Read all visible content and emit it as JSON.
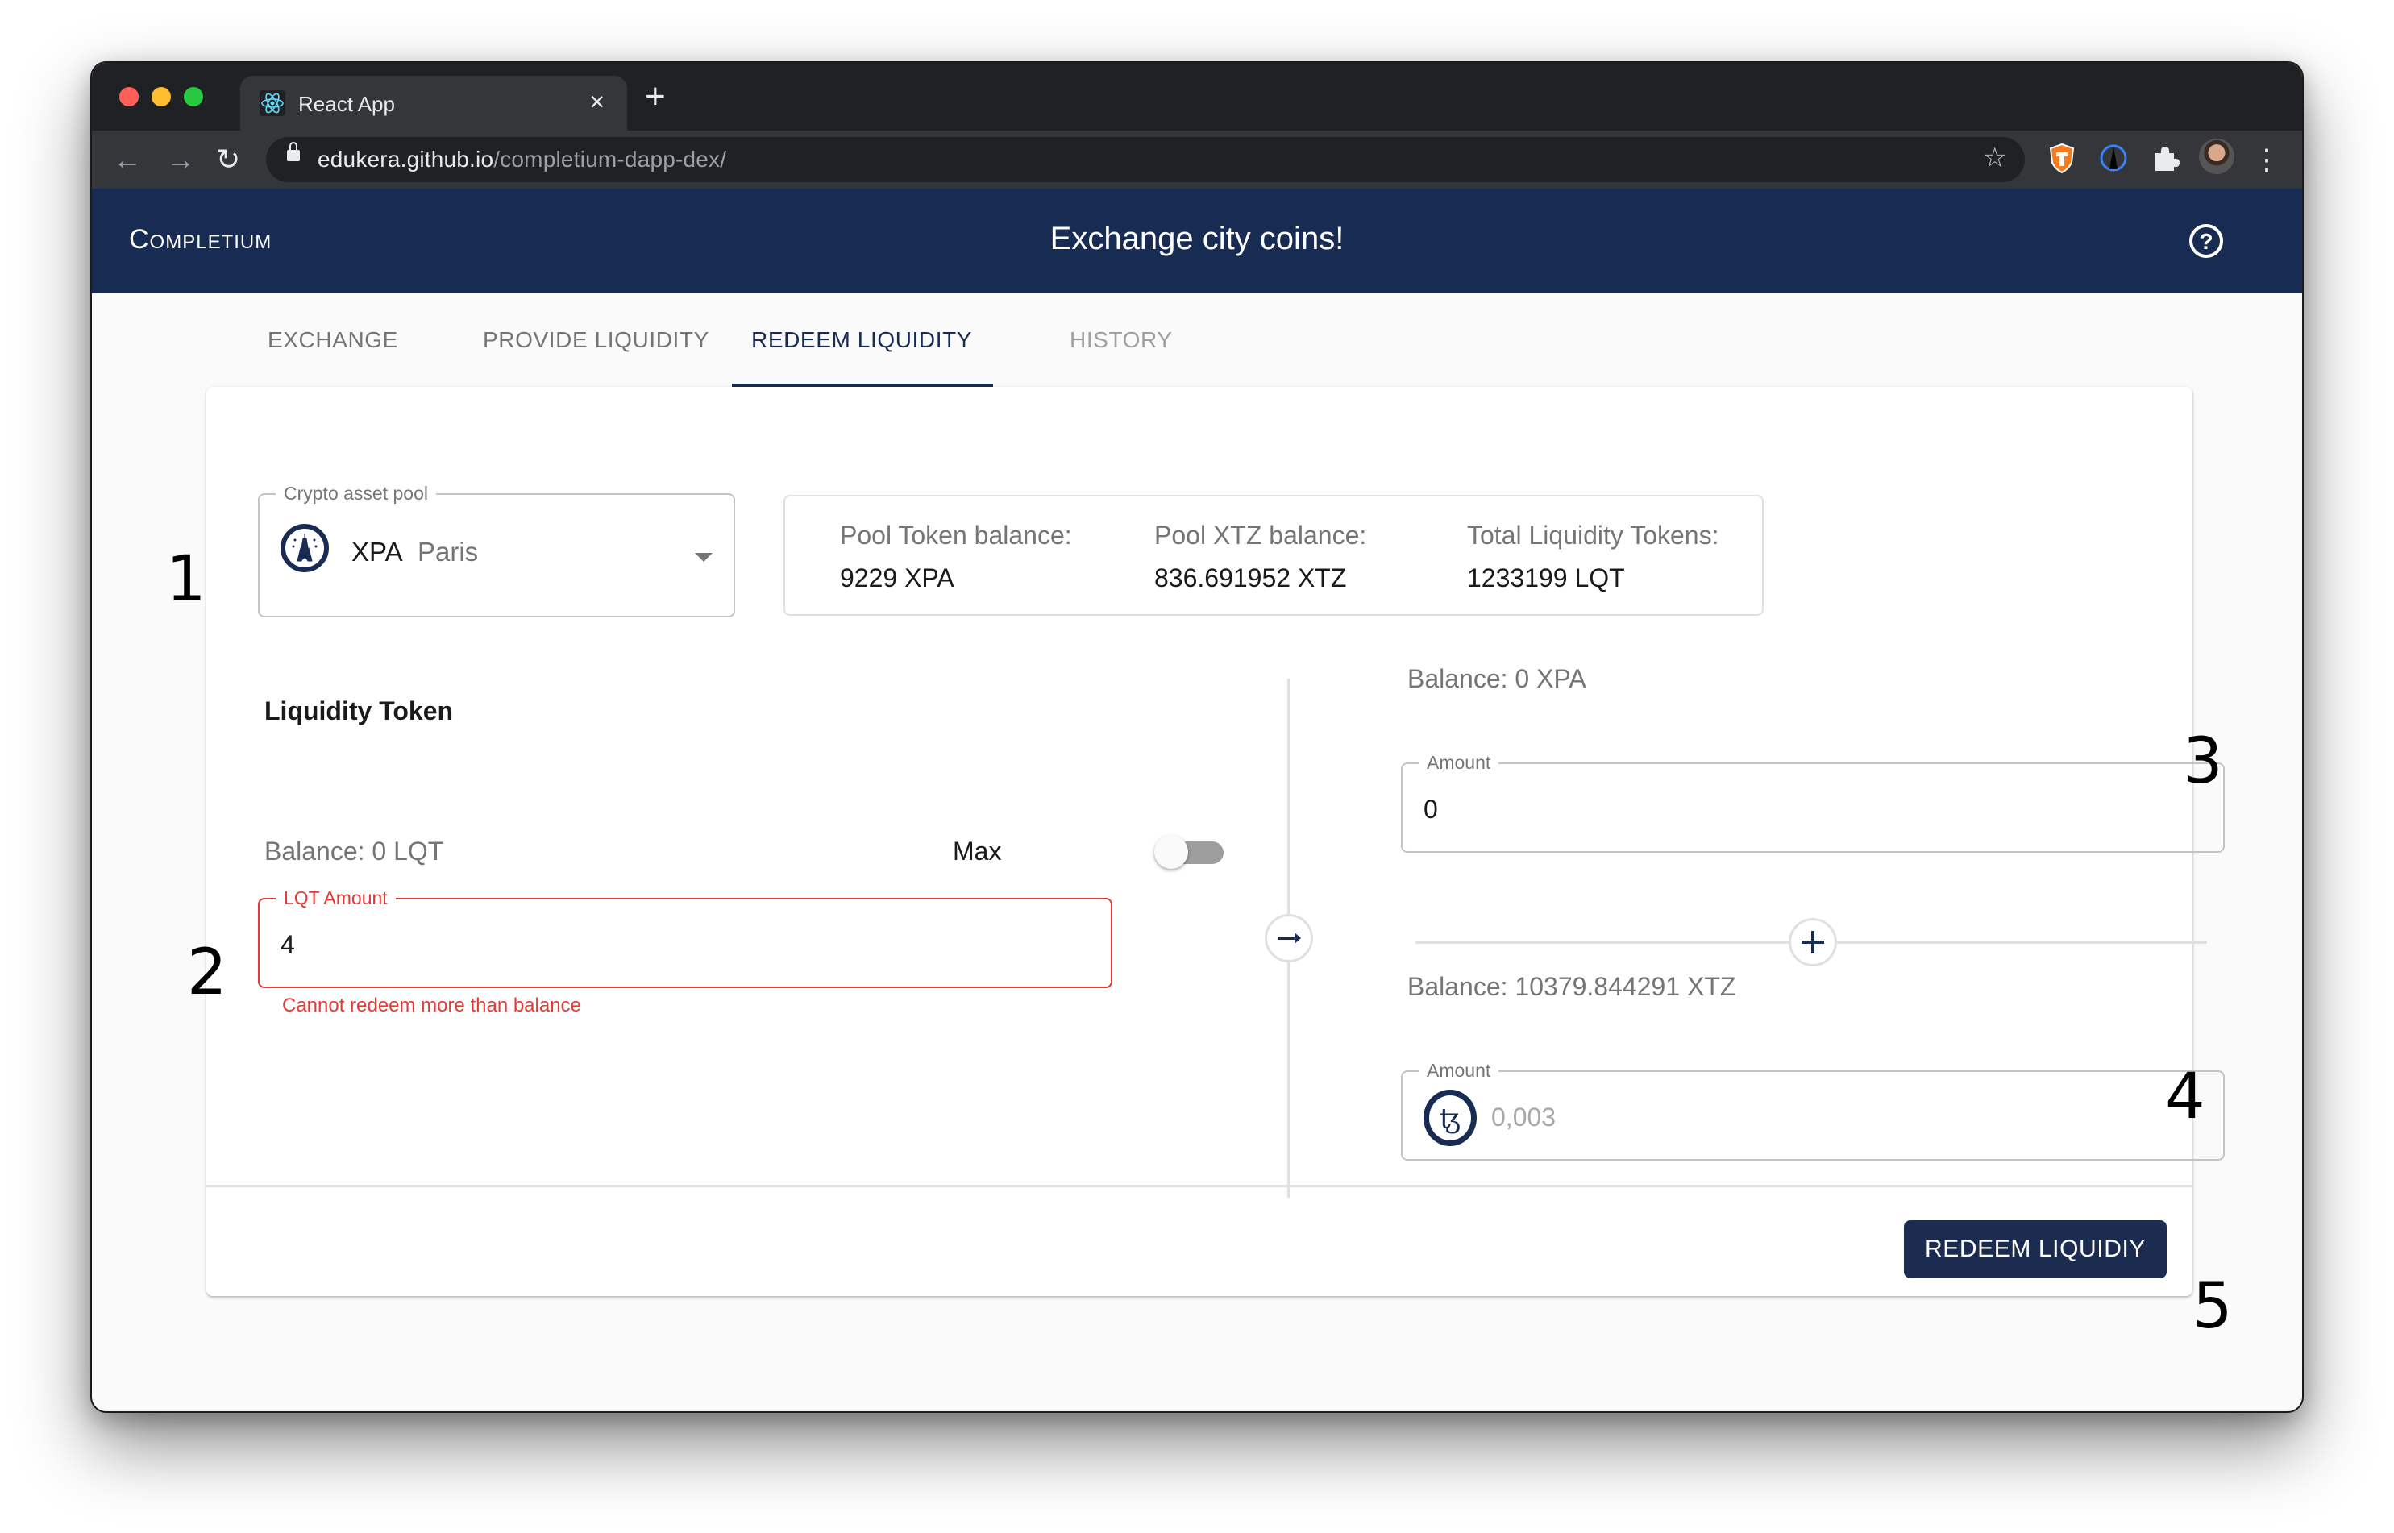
{
  "browser": {
    "tab_title": "React App",
    "tab_close": "×",
    "new_tab": "+",
    "url_host": "edukera.github.io",
    "url_path": "/completium-dapp-dex/",
    "back": "←",
    "forward": "→",
    "reload": "↻",
    "bookmark": "☆",
    "menu": "⋮"
  },
  "app": {
    "brand": "Completium",
    "title": "Exchange city coins!",
    "help_icon": "?"
  },
  "nav_tabs": [
    {
      "label": "EXCHANGE",
      "state": "inactive"
    },
    {
      "label": "PROVIDE LIQUIDITY",
      "state": "inactive"
    },
    {
      "label": "REDEEM LIQUIDITY",
      "state": "active"
    },
    {
      "label": "HISTORY",
      "state": "disabled"
    }
  ],
  "pool_select": {
    "label": "Crypto asset pool",
    "code": "XPA",
    "name": "Paris",
    "icon": "eiffel-tower-icon"
  },
  "pool_info": [
    {
      "label": "Pool Token balance:",
      "value": "9229 XPA"
    },
    {
      "label": "Pool XTZ balance:",
      "value": "836.691952 XTZ"
    },
    {
      "label": "Total Liquidity Tokens:",
      "value": "1233199 LQT"
    }
  ],
  "liquidity": {
    "title": "Liquidity Token",
    "balance": "Balance: 0 LQT",
    "max_label": "Max",
    "max_enabled": false,
    "amount_label": "LQT Amount",
    "amount_value": "4",
    "error": "Cannot redeem more than balance"
  },
  "token_out": {
    "balance": "Balance: 0 XPA",
    "amount_label": "Amount",
    "amount_value": "0"
  },
  "xtz_out": {
    "balance": "Balance: 10379.844291 XTZ",
    "amount_label": "Amount",
    "amount_placeholder": "0,003"
  },
  "arrow_icon": "→",
  "plus_icon": "+",
  "action": {
    "redeem_label": "REDEEM LIQUIDIY"
  },
  "annotations": [
    "1",
    "2",
    "3",
    "4",
    "5"
  ],
  "colors": {
    "primary": "#182b52",
    "error": "#e53935"
  }
}
